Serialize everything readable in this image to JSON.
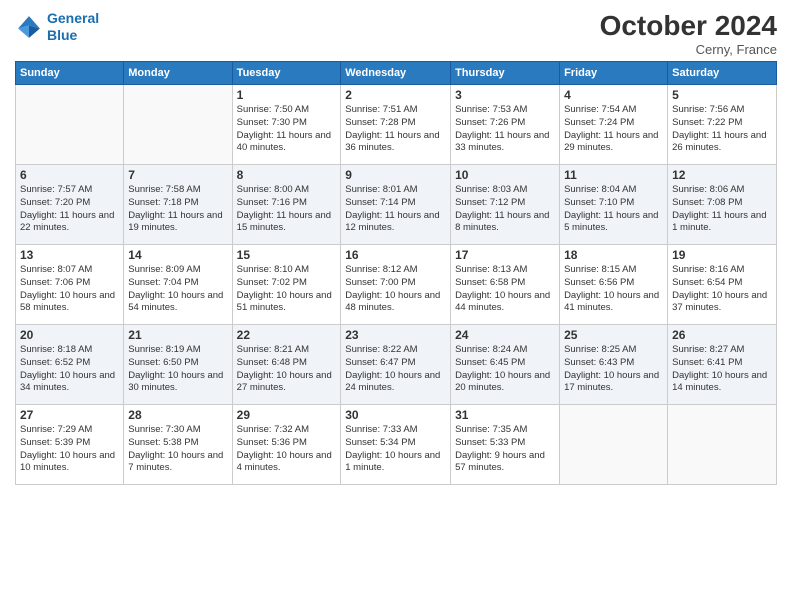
{
  "header": {
    "logo_line1": "General",
    "logo_line2": "Blue",
    "month_title": "October 2024",
    "location": "Cerny, France"
  },
  "weekdays": [
    "Sunday",
    "Monday",
    "Tuesday",
    "Wednesday",
    "Thursday",
    "Friday",
    "Saturday"
  ],
  "days": [
    {
      "day": "",
      "sunrise": "",
      "sunset": "",
      "daylight": ""
    },
    {
      "day": "",
      "sunrise": "",
      "sunset": "",
      "daylight": ""
    },
    {
      "day": "1",
      "sunrise": "Sunrise: 7:50 AM",
      "sunset": "Sunset: 7:30 PM",
      "daylight": "Daylight: 11 hours and 40 minutes."
    },
    {
      "day": "2",
      "sunrise": "Sunrise: 7:51 AM",
      "sunset": "Sunset: 7:28 PM",
      "daylight": "Daylight: 11 hours and 36 minutes."
    },
    {
      "day": "3",
      "sunrise": "Sunrise: 7:53 AM",
      "sunset": "Sunset: 7:26 PM",
      "daylight": "Daylight: 11 hours and 33 minutes."
    },
    {
      "day": "4",
      "sunrise": "Sunrise: 7:54 AM",
      "sunset": "Sunset: 7:24 PM",
      "daylight": "Daylight: 11 hours and 29 minutes."
    },
    {
      "day": "5",
      "sunrise": "Sunrise: 7:56 AM",
      "sunset": "Sunset: 7:22 PM",
      "daylight": "Daylight: 11 hours and 26 minutes."
    },
    {
      "day": "6",
      "sunrise": "Sunrise: 7:57 AM",
      "sunset": "Sunset: 7:20 PM",
      "daylight": "Daylight: 11 hours and 22 minutes."
    },
    {
      "day": "7",
      "sunrise": "Sunrise: 7:58 AM",
      "sunset": "Sunset: 7:18 PM",
      "daylight": "Daylight: 11 hours and 19 minutes."
    },
    {
      "day": "8",
      "sunrise": "Sunrise: 8:00 AM",
      "sunset": "Sunset: 7:16 PM",
      "daylight": "Daylight: 11 hours and 15 minutes."
    },
    {
      "day": "9",
      "sunrise": "Sunrise: 8:01 AM",
      "sunset": "Sunset: 7:14 PM",
      "daylight": "Daylight: 11 hours and 12 minutes."
    },
    {
      "day": "10",
      "sunrise": "Sunrise: 8:03 AM",
      "sunset": "Sunset: 7:12 PM",
      "daylight": "Daylight: 11 hours and 8 minutes."
    },
    {
      "day": "11",
      "sunrise": "Sunrise: 8:04 AM",
      "sunset": "Sunset: 7:10 PM",
      "daylight": "Daylight: 11 hours and 5 minutes."
    },
    {
      "day": "12",
      "sunrise": "Sunrise: 8:06 AM",
      "sunset": "Sunset: 7:08 PM",
      "daylight": "Daylight: 11 hours and 1 minute."
    },
    {
      "day": "13",
      "sunrise": "Sunrise: 8:07 AM",
      "sunset": "Sunset: 7:06 PM",
      "daylight": "Daylight: 10 hours and 58 minutes."
    },
    {
      "day": "14",
      "sunrise": "Sunrise: 8:09 AM",
      "sunset": "Sunset: 7:04 PM",
      "daylight": "Daylight: 10 hours and 54 minutes."
    },
    {
      "day": "15",
      "sunrise": "Sunrise: 8:10 AM",
      "sunset": "Sunset: 7:02 PM",
      "daylight": "Daylight: 10 hours and 51 minutes."
    },
    {
      "day": "16",
      "sunrise": "Sunrise: 8:12 AM",
      "sunset": "Sunset: 7:00 PM",
      "daylight": "Daylight: 10 hours and 48 minutes."
    },
    {
      "day": "17",
      "sunrise": "Sunrise: 8:13 AM",
      "sunset": "Sunset: 6:58 PM",
      "daylight": "Daylight: 10 hours and 44 minutes."
    },
    {
      "day": "18",
      "sunrise": "Sunrise: 8:15 AM",
      "sunset": "Sunset: 6:56 PM",
      "daylight": "Daylight: 10 hours and 41 minutes."
    },
    {
      "day": "19",
      "sunrise": "Sunrise: 8:16 AM",
      "sunset": "Sunset: 6:54 PM",
      "daylight": "Daylight: 10 hours and 37 minutes."
    },
    {
      "day": "20",
      "sunrise": "Sunrise: 8:18 AM",
      "sunset": "Sunset: 6:52 PM",
      "daylight": "Daylight: 10 hours and 34 minutes."
    },
    {
      "day": "21",
      "sunrise": "Sunrise: 8:19 AM",
      "sunset": "Sunset: 6:50 PM",
      "daylight": "Daylight: 10 hours and 30 minutes."
    },
    {
      "day": "22",
      "sunrise": "Sunrise: 8:21 AM",
      "sunset": "Sunset: 6:48 PM",
      "daylight": "Daylight: 10 hours and 27 minutes."
    },
    {
      "day": "23",
      "sunrise": "Sunrise: 8:22 AM",
      "sunset": "Sunset: 6:47 PM",
      "daylight": "Daylight: 10 hours and 24 minutes."
    },
    {
      "day": "24",
      "sunrise": "Sunrise: 8:24 AM",
      "sunset": "Sunset: 6:45 PM",
      "daylight": "Daylight: 10 hours and 20 minutes."
    },
    {
      "day": "25",
      "sunrise": "Sunrise: 8:25 AM",
      "sunset": "Sunset: 6:43 PM",
      "daylight": "Daylight: 10 hours and 17 minutes."
    },
    {
      "day": "26",
      "sunrise": "Sunrise: 8:27 AM",
      "sunset": "Sunset: 6:41 PM",
      "daylight": "Daylight: 10 hours and 14 minutes."
    },
    {
      "day": "27",
      "sunrise": "Sunrise: 7:29 AM",
      "sunset": "Sunset: 5:39 PM",
      "daylight": "Daylight: 10 hours and 10 minutes."
    },
    {
      "day": "28",
      "sunrise": "Sunrise: 7:30 AM",
      "sunset": "Sunset: 5:38 PM",
      "daylight": "Daylight: 10 hours and 7 minutes."
    },
    {
      "day": "29",
      "sunrise": "Sunrise: 7:32 AM",
      "sunset": "Sunset: 5:36 PM",
      "daylight": "Daylight: 10 hours and 4 minutes."
    },
    {
      "day": "30",
      "sunrise": "Sunrise: 7:33 AM",
      "sunset": "Sunset: 5:34 PM",
      "daylight": "Daylight: 10 hours and 1 minute."
    },
    {
      "day": "31",
      "sunrise": "Sunrise: 7:35 AM",
      "sunset": "Sunset: 5:33 PM",
      "daylight": "Daylight: 9 hours and 57 minutes."
    },
    {
      "day": "",
      "sunrise": "",
      "sunset": "",
      "daylight": ""
    },
    {
      "day": "",
      "sunrise": "",
      "sunset": "",
      "daylight": ""
    }
  ]
}
